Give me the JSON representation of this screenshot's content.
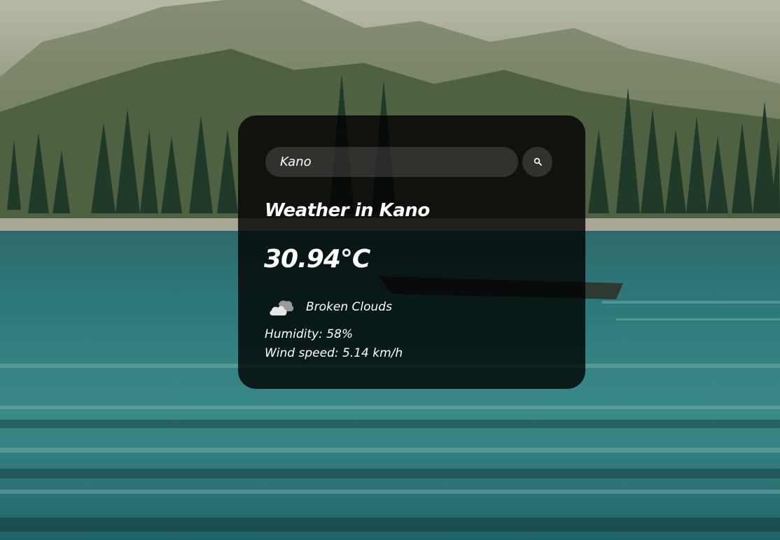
{
  "search": {
    "value": "Kano",
    "button_icon": "search-icon"
  },
  "weather": {
    "city_heading": "Weather in Kano",
    "temperature": "30.94°C",
    "condition_icon": "broken-clouds-icon",
    "description": "Broken Clouds",
    "humidity": "Humidity: 58%",
    "wind_speed": "Wind speed: 5.14 km/h"
  },
  "colors": {
    "card_background": "rgba(0,0,0,0.80)",
    "input_background": "rgba(124,124,124,0.30)",
    "text": "#ffffff"
  }
}
